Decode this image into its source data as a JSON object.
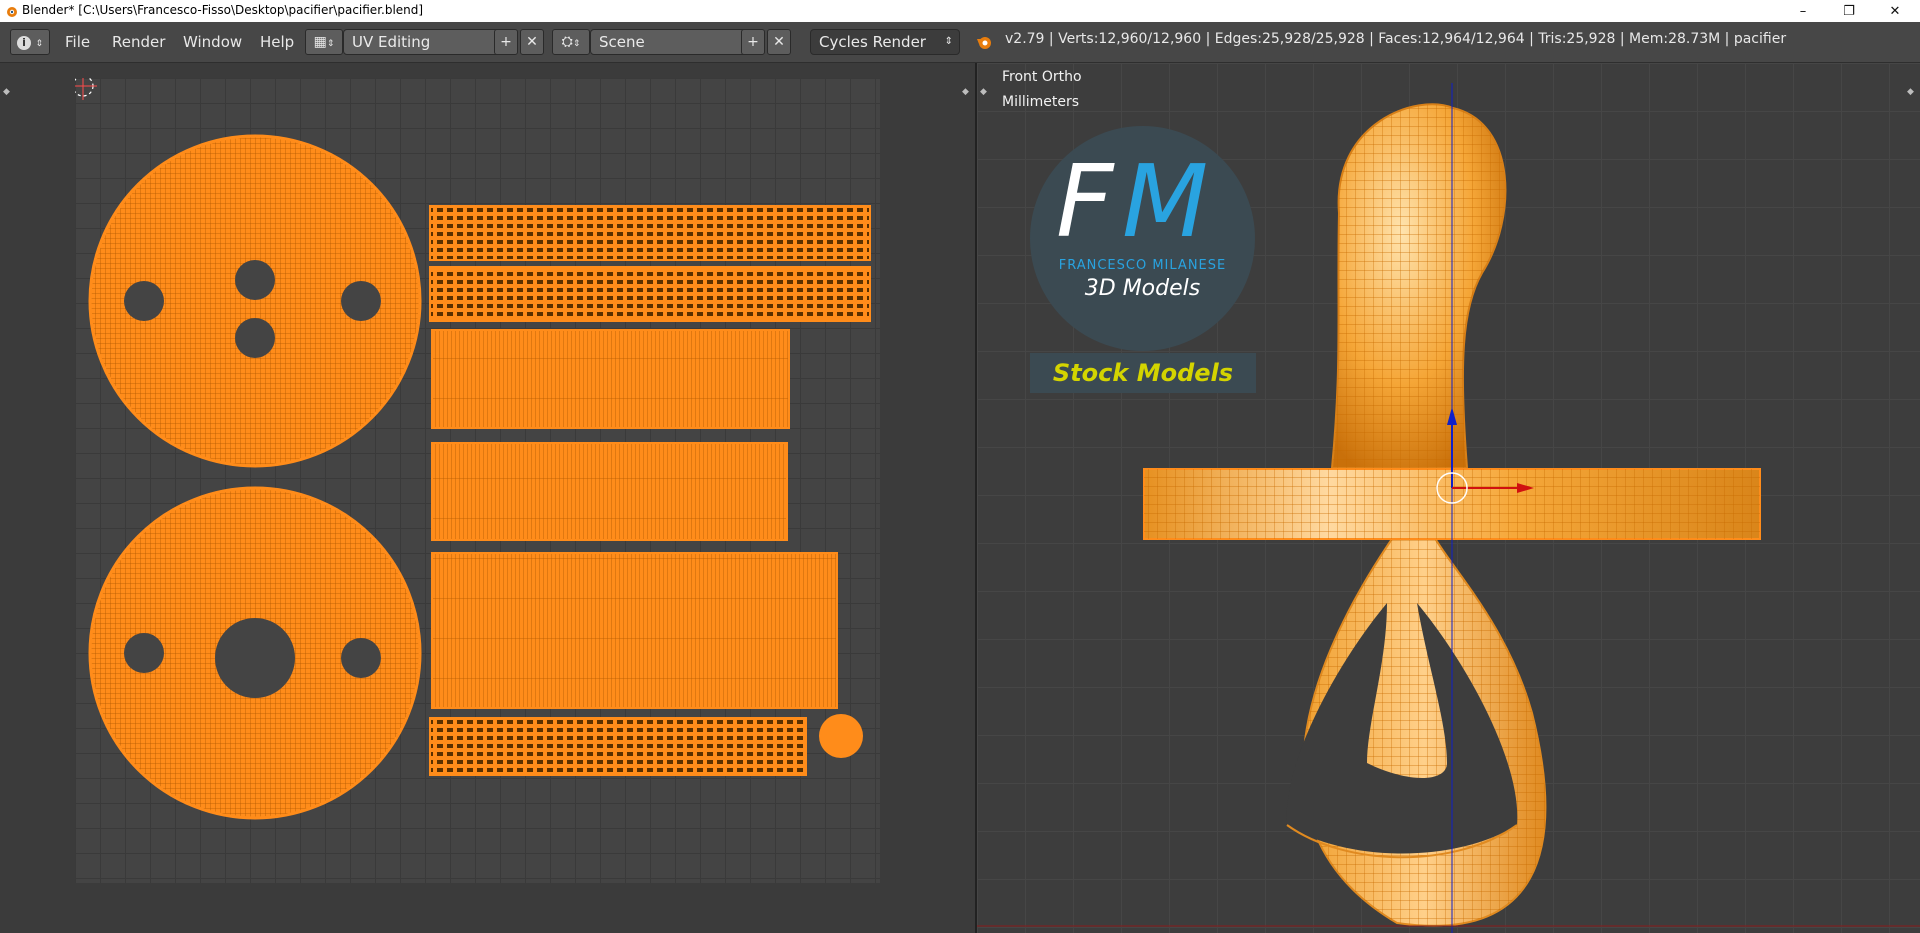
{
  "window": {
    "title": "Blender* [C:\\Users\\Francesco-Fisso\\Desktop\\pacifier\\pacifier.blend]",
    "controls": {
      "minimize": "–",
      "restore": "❐",
      "close": "✕"
    }
  },
  "header": {
    "info_icon": "i",
    "menus": [
      "File",
      "Render",
      "Window",
      "Help"
    ],
    "screen_layout": "UV Editing",
    "scene": "Scene",
    "render_engine": "Cycles Render",
    "stats": "v2.79 | Verts:12,960/12,960 | Edges:25,928/25,928 | Faces:12,964/12,964 | Tris:25,928 | Mem:28.73M | pacifier"
  },
  "viewport": {
    "view_label": "Front Ortho",
    "units_label": "Millimeters"
  },
  "logo": {
    "monogram_f": "F",
    "monogram_m": "M",
    "brand": "FRANCESCO MILANESE",
    "tagline": "3D Models",
    "banner": "Stock Models"
  },
  "colors": {
    "mesh_orange": "#ff8c1a",
    "mesh_wire": "#c85f00",
    "pacifier_fill": "#f5a637",
    "logo_blue": "#29a3e0",
    "banner_yellow": "#d4d400",
    "axis_x": "#d01010",
    "axis_z": "#1020c8"
  },
  "icons": {
    "app": "blender-icon",
    "info": "info-icon",
    "screen": "layout-icon",
    "scene": "scene-icon",
    "render": "render-icon",
    "add": "plus-icon",
    "remove": "close-icon"
  }
}
